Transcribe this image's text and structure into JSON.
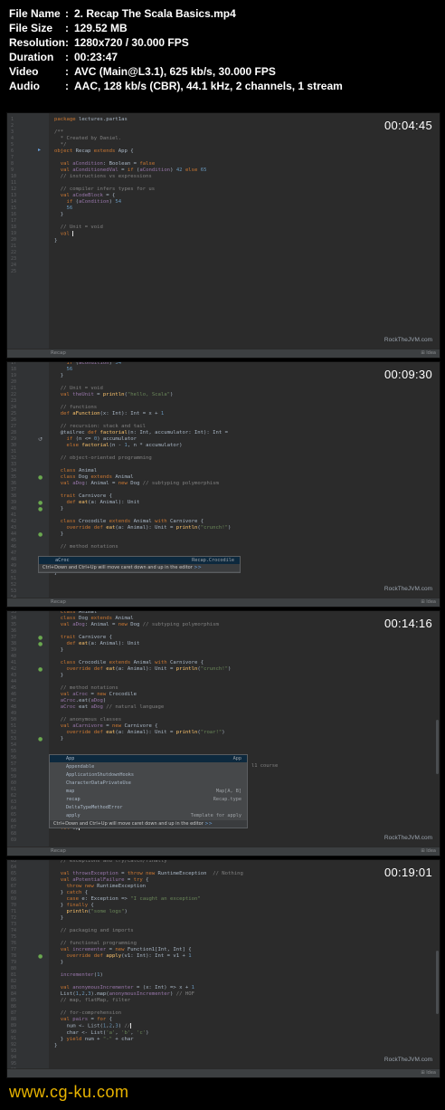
{
  "file_info": {
    "rows": [
      {
        "key": "File Name",
        "sep": ":",
        "value": "2. Recap The Scala Basics.mp4"
      },
      {
        "key": "File Size",
        "sep": ":",
        "value": "129.52 MB"
      },
      {
        "key": "Resolution",
        "sep": ":",
        "value": "1280x720 / 30.000 FPS"
      },
      {
        "key": "Duration",
        "sep": ":",
        "value": "00:23:47"
      },
      {
        "key": "Video",
        "sep": ":",
        "value": "AVC (Main@L3.1), 625 kb/s, 30.000 FPS"
      },
      {
        "key": "Audio",
        "sep": ":",
        "value": "AAC, 128 kb/s (CBR), 44.1 kHz, 2 channels, 1 stream"
      }
    ]
  },
  "frames": [
    {
      "timestamp": "00:04:45",
      "watermark": "RockTheJVM.com",
      "bar_label": "Recap",
      "bar_icon": "⊞ Idea"
    },
    {
      "timestamp": "00:09:30",
      "watermark": "RockTheJVM.com",
      "bar_label": "Recap",
      "bar_icon": "⊞ Idea",
      "popup": {
        "item_left": "aCroc",
        "item_right": "Recap.Crocodile",
        "hint": "Ctrl+Down and Ctrl+Up will move caret down and up in the editor",
        "hint_tail": ">>"
      }
    },
    {
      "timestamp": "00:14:16",
      "watermark": "RockTheJVM.com",
      "bar_label": "Recap",
      "bar_icon": "⊞ Idea",
      "side_text": "l1 course",
      "popup": {
        "items": [
          {
            "l": "App",
            "r": "App"
          },
          {
            "l": "Appendable",
            "r": ""
          },
          {
            "l": "ApplicationShutdownHooks",
            "r": ""
          },
          {
            "l": "CharacterDataPrivateUse",
            "r": ""
          },
          {
            "l": "map",
            "r": "Map[A, B]"
          },
          {
            "l": "recap",
            "r": "Recap.type"
          },
          {
            "l": "DeltaTypeMethodError",
            "r": ""
          },
          {
            "l": "apply",
            "r": "Template for apply"
          }
        ],
        "hint": "Ctrl+Down and Ctrl+Up will move caret down and up in the editor",
        "hint_tail": ">>"
      }
    },
    {
      "timestamp": "00:19:01",
      "watermark": "RockTheJVM.com",
      "bar_label": "",
      "bar_icon": "⊞ Idea"
    }
  ],
  "site_watermark": "www.cg-ku.com",
  "colors": {
    "editor_bg": "#2b2b2b",
    "gutter_bg": "#313335",
    "keyword": "#cc7832",
    "string": "#6a8759",
    "comment": "#808080",
    "number": "#6897bb",
    "function": "#ffc66d",
    "field": "#9876aa",
    "watermark_yellow": "#e8b400"
  }
}
